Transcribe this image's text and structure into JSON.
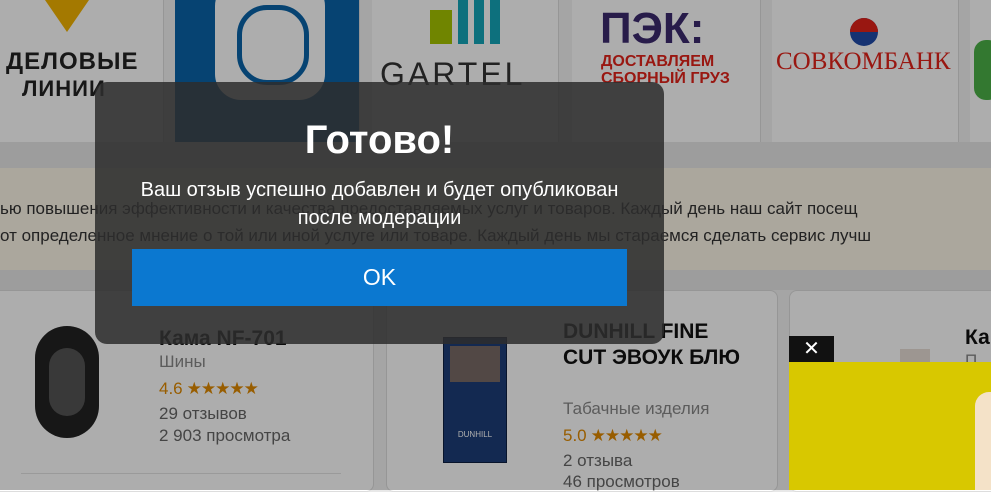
{
  "logos": {
    "delovye": "ДΕЛОВЫΕ",
    "delovye_line2": "ЛИНИИ",
    "gartel": "GARTEL",
    "pek": "ПЭК:",
    "pek_sub1": "ДОСТАВЛЯЕМ",
    "pek_sub2": "СБОРНЫЙ ГРУЗ",
    "sovcom": "СОВКОМБАНК"
  },
  "notice": {
    "line1": "ью повышения эффективности и качества предоставляемых услуг и товаров. Каждый день наш сайт посещ",
    "line2": "от определенное мнение о той или иной услуге или товаре. Каждый день мы стараемся сделать сервис лучш"
  },
  "products": [
    {
      "title": "Кама NF-701",
      "category": "Шины",
      "rating": "4.6",
      "stars": "★★★★★",
      "reviews": "29 отзывов",
      "views": "2 903 просмотра"
    },
    {
      "title": "DUNHILL FINE CUT ЭВОУК БЛЮ",
      "category": "Табачные изделия",
      "rating": "5.0",
      "stars": "★★★★★",
      "reviews": "2 отзыва",
      "views": "46 просмотров",
      "pack_label": "DUNHILL"
    },
    {
      "title": "Ка",
      "category": "П"
    }
  ],
  "modal": {
    "title": "Готово!",
    "message": "Ваш отзыв успешно добавлен и будет опубликован после модерации",
    "ok_label": "OK"
  },
  "ad": {
    "close_glyph": "✕"
  },
  "colors": {
    "accent": "#0b78d0",
    "rating": "#e08a00",
    "pek_purple": "#3b2a6e",
    "sovcom_red": "#e2231a",
    "sovcom_blue": "#1f4aa8"
  }
}
